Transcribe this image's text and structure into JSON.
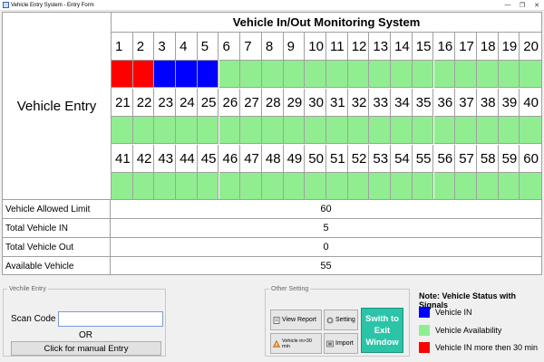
{
  "window": {
    "title": "Vehicle Entry System - Entry Form",
    "minimize": "—",
    "maximize": "❐",
    "close": "✕"
  },
  "colors": {
    "in": "#0000ff",
    "available": "#90ee90",
    "overdue": "#ff0000"
  },
  "monitor": {
    "left_label": "Vehicle Entry",
    "title": "Vehicle In/Out Monitoring System",
    "rows": [
      {
        "numbers": [
          "1",
          "2",
          "3",
          "4",
          "5",
          "6",
          "7",
          "8",
          "9",
          "10",
          "11",
          "12",
          "13",
          "14",
          "15",
          "16",
          "17",
          "18",
          "19",
          "20"
        ],
        "status": [
          "overdue",
          "overdue",
          "in",
          "in",
          "in",
          "available",
          "available",
          "available",
          "available",
          "available",
          "available",
          "available",
          "available",
          "available",
          "available",
          "available",
          "available",
          "available",
          "available",
          "available"
        ]
      },
      {
        "numbers": [
          "21",
          "22",
          "23",
          "24",
          "25",
          "26",
          "27",
          "28",
          "29",
          "30",
          "31",
          "32",
          "33",
          "34",
          "35",
          "36",
          "37",
          "38",
          "39",
          "40"
        ],
        "status": [
          "available",
          "available",
          "available",
          "available",
          "available",
          "available",
          "available",
          "available",
          "available",
          "available",
          "available",
          "available",
          "available",
          "available",
          "available",
          "available",
          "available",
          "available",
          "available",
          "available"
        ]
      },
      {
        "numbers": [
          "41",
          "42",
          "43",
          "44",
          "45",
          "46",
          "47",
          "48",
          "49",
          "50",
          "51",
          "52",
          "53",
          "54",
          "55",
          "56",
          "57",
          "58",
          "59",
          "60"
        ],
        "status": [
          "available",
          "available",
          "available",
          "available",
          "available",
          "available",
          "available",
          "available",
          "available",
          "available",
          "available",
          "available",
          "available",
          "available",
          "available",
          "available",
          "available",
          "available",
          "available",
          "available"
        ]
      }
    ]
  },
  "stats": [
    {
      "label": "Vehicle Allowed Limit",
      "value": "60"
    },
    {
      "label": "Total Vehicle IN",
      "value": "5"
    },
    {
      "label": "Total Vehicle Out",
      "value": "0"
    },
    {
      "label": "Available Vehicle",
      "value": "55"
    }
  ],
  "entry": {
    "legend": "Vechile Entry",
    "scan_label": "Scan Code",
    "scan_value": "",
    "or": "OR",
    "manual_button": "Click for manual Entry"
  },
  "other": {
    "legend": "Other Setting",
    "view_report": "View Report",
    "setting": "Setting",
    "vehicle_in_30": "Vehicle in>30 min",
    "import": "Import",
    "exit": "Swith to Exit Window"
  },
  "legend": {
    "title": "Note: Vehicle Status with Signals",
    "items": [
      {
        "label": "Vehicle IN",
        "color": "#0000ff"
      },
      {
        "label": "Vehicle Availability",
        "color": "#90ee90"
      },
      {
        "label": "Vehicle IN more then 30 min",
        "color": "#ff0000"
      }
    ]
  }
}
